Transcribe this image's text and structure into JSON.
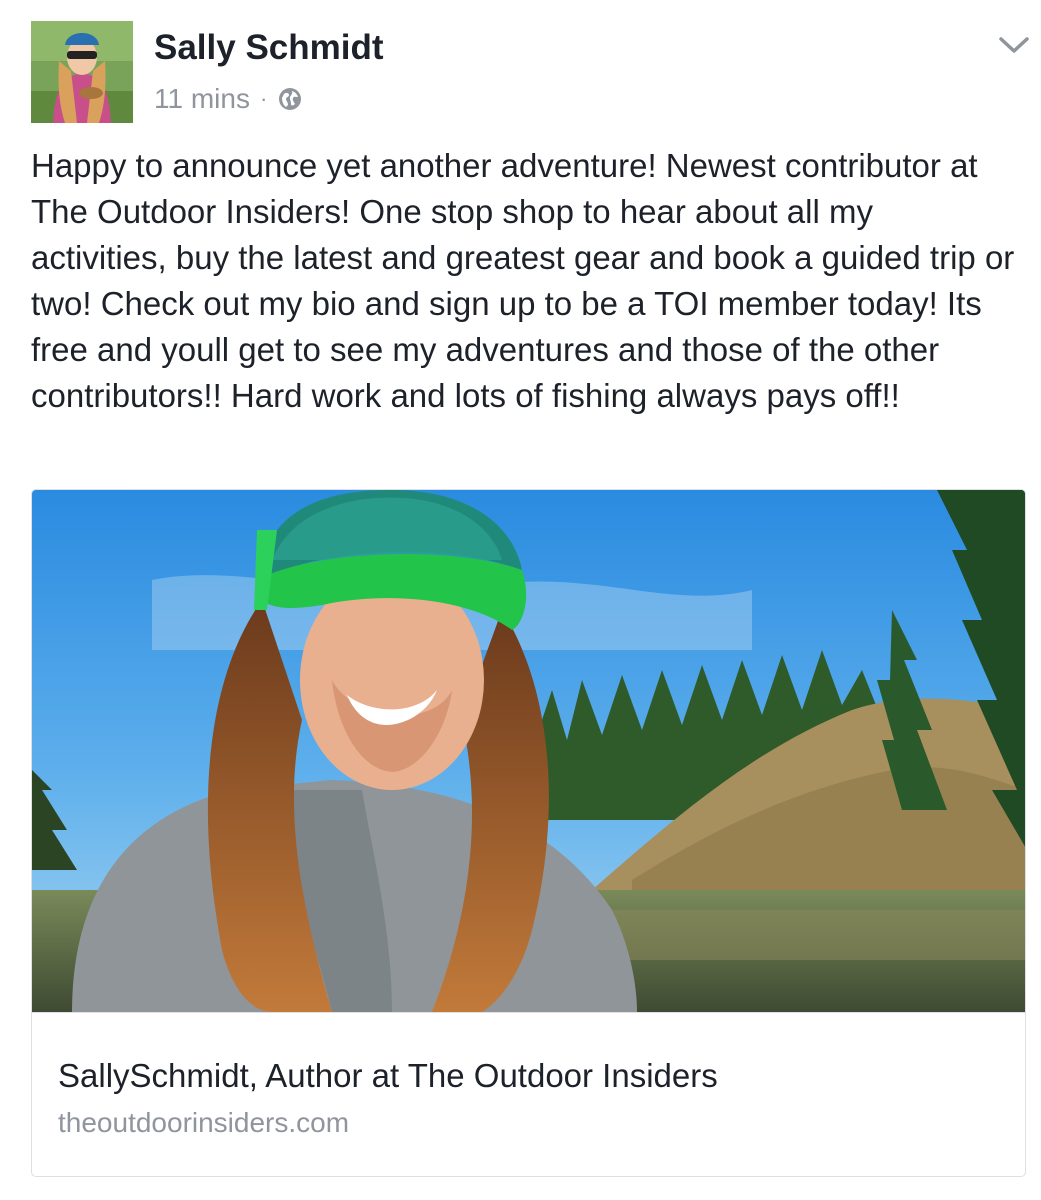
{
  "post": {
    "author": "Sally Schmidt",
    "timestamp": "11 mins",
    "separator": "·",
    "privacy_icon": "globe-icon",
    "menu_icon": "chevron-down-icon",
    "text": "Happy to announce yet another adventure! Newest contributor at The Outdoor Insiders! One stop shop to hear about all my activities, buy the latest and greatest gear and book a guided trip or two! Check out my bio and sign up to be a TOI member today! Its free and youll get to see my adventures and those of the other contributors!! Hard work and lots of fishing always pays off!!"
  },
  "link_card": {
    "title": "SallySchmidt, Author at The Outdoor Insiders",
    "domain": "theoutdoorinsiders.com"
  },
  "colors": {
    "primary_text": "#1d2129",
    "secondary_text": "#90949c",
    "border": "#dddfe2"
  }
}
